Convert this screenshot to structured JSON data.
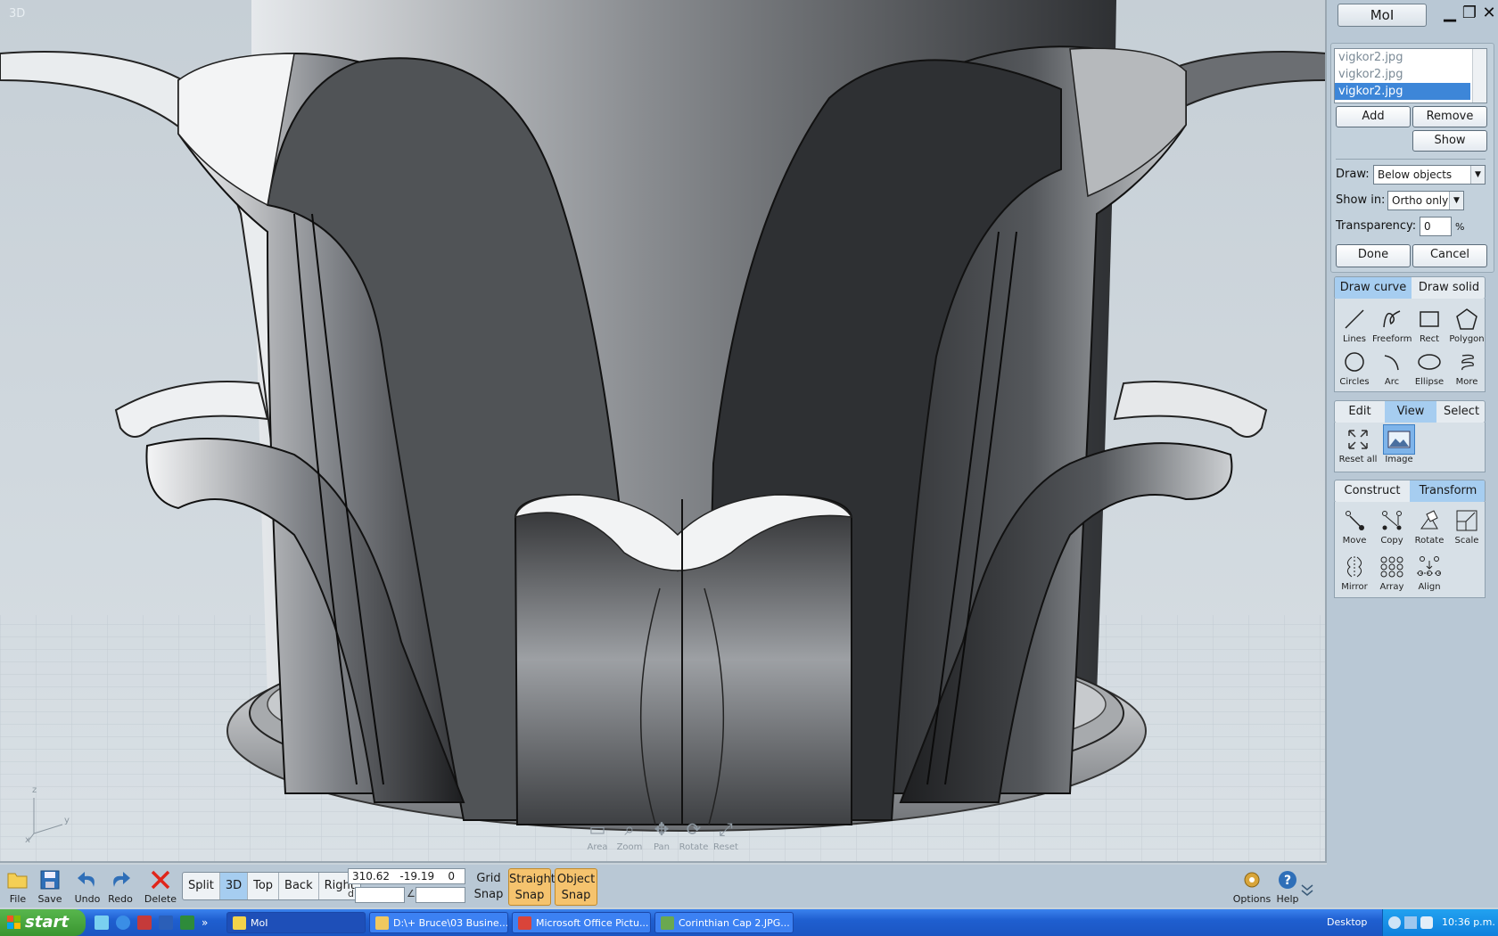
{
  "viewport": {
    "label": "3D",
    "axis": {
      "z": "z",
      "y": "y",
      "x": "x"
    },
    "nav": [
      {
        "name": "area",
        "label": "Area",
        "glyph": "▭"
      },
      {
        "name": "zoom",
        "label": "Zoom",
        "glyph": "⌕"
      },
      {
        "name": "pan",
        "label": "Pan",
        "glyph": "✥"
      },
      {
        "name": "rotate",
        "label": "Rotate",
        "glyph": "⟳"
      },
      {
        "name": "reset",
        "label": "Reset",
        "glyph": "⤢"
      }
    ]
  },
  "panel": {
    "app_title": "MoI",
    "window_controls": {
      "minimize": "▁",
      "restore": "❐",
      "close": "✕"
    },
    "images": [
      "vigkor2.jpg",
      "vigkor2.jpg",
      "vigkor2.jpg"
    ],
    "selected_image_index": 2,
    "buttons": {
      "add": "Add",
      "remove": "Remove",
      "show": "Show",
      "done": "Done",
      "cancel": "Cancel"
    },
    "draw": {
      "label": "Draw:",
      "value": "Below objects"
    },
    "show_in": {
      "label": "Show in:",
      "value": "Ortho only"
    },
    "transparency": {
      "label": "Transparency:",
      "value": "0",
      "unit": "%"
    },
    "draw_tabs": [
      "Draw curve",
      "Draw solid"
    ],
    "draw_tools": [
      {
        "label": "Lines",
        "icon": "line-icon"
      },
      {
        "label": "Freeform",
        "icon": "freeform-icon"
      },
      {
        "label": "Rect",
        "icon": "rectangle-icon"
      },
      {
        "label": "Polygon",
        "icon": "polygon-icon"
      },
      {
        "label": "Circles",
        "icon": "circle-icon"
      },
      {
        "label": "Arc",
        "icon": "arc-icon"
      },
      {
        "label": "Ellipse",
        "icon": "ellipse-icon"
      },
      {
        "label": "More",
        "icon": "helix-icon"
      }
    ],
    "mid_tabs": [
      "Edit",
      "View",
      "Select"
    ],
    "view_tools": [
      {
        "label": "Reset all",
        "icon": "reset-all-icon"
      },
      {
        "label": "Image",
        "icon": "image-icon"
      }
    ],
    "bottom_tabs": [
      "Construct",
      "Transform"
    ],
    "transform_tools": [
      {
        "label": "Move",
        "icon": "move-icon"
      },
      {
        "label": "Copy",
        "icon": "copy-icon"
      },
      {
        "label": "Rotate",
        "icon": "rotate-icon"
      },
      {
        "label": "Scale",
        "icon": "scale-icon"
      },
      {
        "label": "Mirror",
        "icon": "mirror-icon"
      },
      {
        "label": "Array",
        "icon": "array-icon"
      },
      {
        "label": "Align",
        "icon": "align-icon"
      }
    ]
  },
  "toolbar": {
    "file": "File",
    "save": "Save",
    "undo": "Undo",
    "redo": "Redo",
    "delete": "Delete",
    "views": [
      "Split",
      "3D",
      "Top",
      "Back",
      "Right"
    ],
    "active_view": "3D",
    "coords": "310.62   -19.19    0",
    "d_symbol": "d",
    "angle_symbol": "∠",
    "grid_snap": {
      "line1": "Grid",
      "line2": "Snap"
    },
    "straight_snap": {
      "line1": "Straight",
      "line2": "Snap"
    },
    "object_snap": {
      "line1": "Object",
      "line2": "Snap"
    },
    "options": "Options",
    "help": "Help"
  },
  "taskbar": {
    "start": "start",
    "tasks": [
      {
        "label": "MoI",
        "icon": "moi-icon",
        "color": "#f2d34a"
      },
      {
        "label": "D:\\+ Bruce\\03 Busine...",
        "icon": "folder-icon",
        "color": "#f0c860"
      },
      {
        "label": "Microsoft Office Pictu...",
        "icon": "picture-manager-icon",
        "color": "#d9443a"
      },
      {
        "label": "Corinthian Cap 2.JPG...",
        "icon": "image-viewer-icon",
        "color": "#6aa84f"
      }
    ],
    "desktop": "Desktop",
    "clock": "10:36 p.m."
  }
}
